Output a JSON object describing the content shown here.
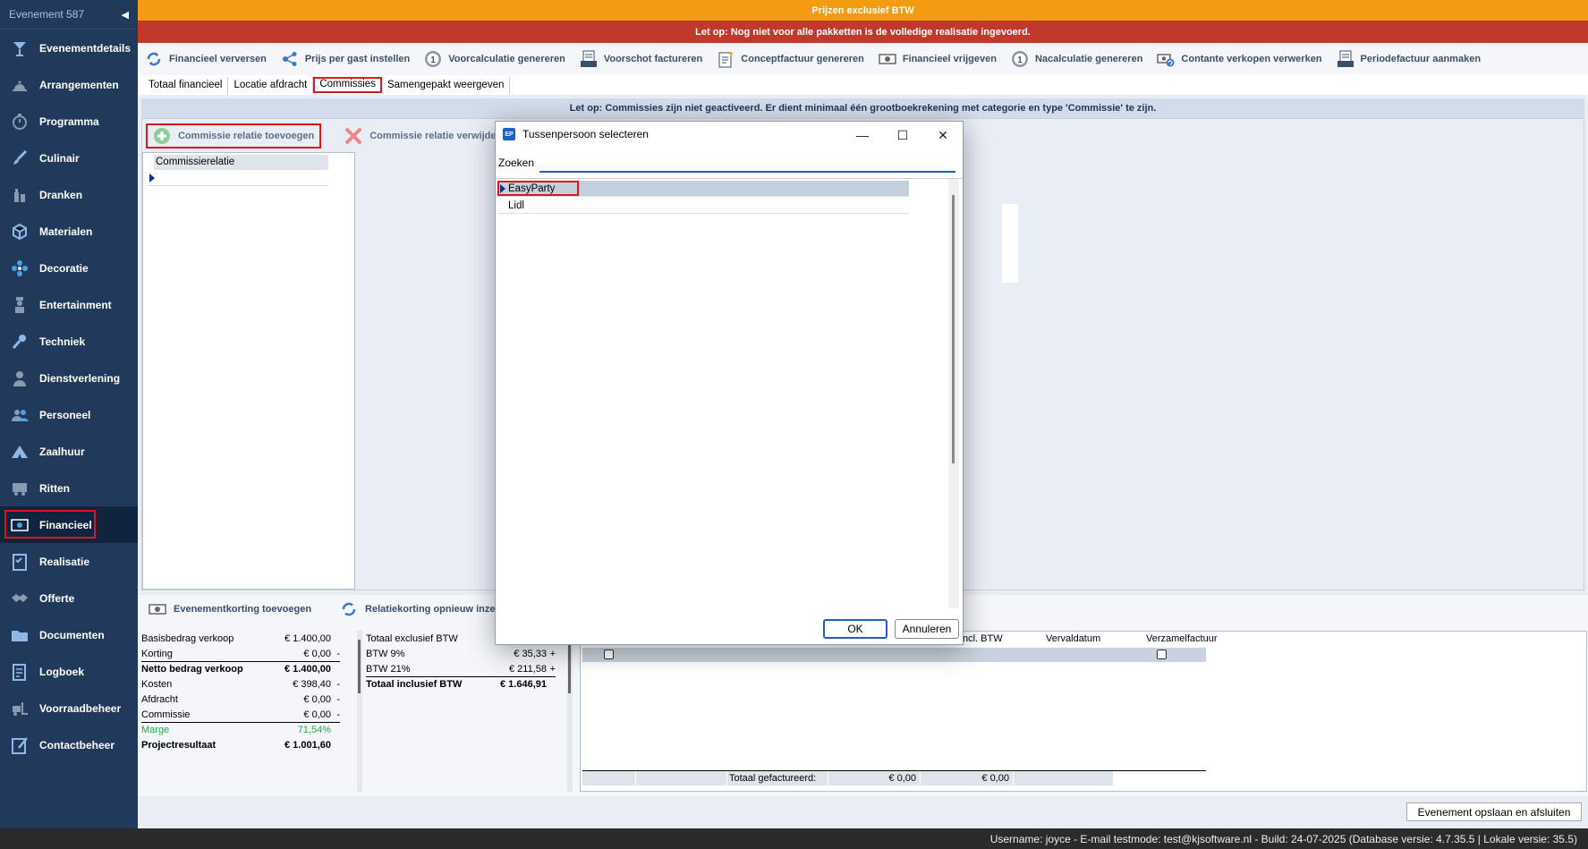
{
  "sidebar": {
    "event_title": "Evenement 587",
    "items": [
      {
        "label": "Evenementdetails",
        "icon": "cocktail-icon"
      },
      {
        "label": "Arrangementen",
        "icon": "bell-icon"
      },
      {
        "label": "Programma",
        "icon": "stopwatch-icon"
      },
      {
        "label": "Culinair",
        "icon": "brush-icon"
      },
      {
        "label": "Dranken",
        "icon": "bottles-icon"
      },
      {
        "label": "Materialen",
        "icon": "box-icon"
      },
      {
        "label": "Decoratie",
        "icon": "flower-icon"
      },
      {
        "label": "Entertainment",
        "icon": "performer-icon"
      },
      {
        "label": "Techniek",
        "icon": "microphone-icon"
      },
      {
        "label": "Dienstverlening",
        "icon": "waiter-icon"
      },
      {
        "label": "Personeel",
        "icon": "people-icon"
      },
      {
        "label": "Zaalhuur",
        "icon": "tent-icon"
      },
      {
        "label": "Ritten",
        "icon": "truck-icon"
      },
      {
        "label": "Financieel",
        "icon": "money-icon"
      },
      {
        "label": "Realisatie",
        "icon": "checklist-icon"
      },
      {
        "label": "Offerte",
        "icon": "handshake-icon"
      },
      {
        "label": "Documenten",
        "icon": "folder-icon"
      },
      {
        "label": "Logboek",
        "icon": "logbook-icon"
      },
      {
        "label": "Voorraadbeheer",
        "icon": "forklift-icon"
      },
      {
        "label": "Contactbeheer",
        "icon": "contact-edit-icon"
      }
    ]
  },
  "banners": {
    "orange": "Prijzen exclusief BTW",
    "red": "Let op: Nog niet voor alle pakketten is de volledige realisatie ingevoerd."
  },
  "toolbar": [
    {
      "label": "Financieel verversen",
      "icon": "refresh-icon"
    },
    {
      "label": "Prijs per gast instellen",
      "icon": "share-icon"
    },
    {
      "label": "Voorcalculatie genereren",
      "icon": "number-one-icon"
    },
    {
      "label": "Voorschot factureren",
      "icon": "invoice-icon"
    },
    {
      "label": "Conceptfactuur genereren",
      "icon": "draft-invoice-icon"
    },
    {
      "label": "Financieel vrijgeven",
      "icon": "cash-icon"
    },
    {
      "label": "Nacalculatie genereren",
      "icon": "number-one-icon"
    },
    {
      "label": "Contante verkopen verwerken",
      "icon": "cash-refresh-icon"
    },
    {
      "label": "Periodefactuur aanmaken",
      "icon": "invoice-icon"
    }
  ],
  "tabs": [
    "Totaal financieel",
    "Locatie afdracht",
    "Commissies",
    "Samengepakt weergeven"
  ],
  "commissions": {
    "notice": "Let op: Commissies zijn niet geactiveerd. Er dient minimaal één grootboekrekening met categorie en type 'Commissie' te zijn.",
    "add_label": "Commissie relatie toevoegen",
    "remove_label": "Commissie relatie verwijderen",
    "grid_header": "Commissierelatie"
  },
  "bottom": {
    "discount_label": "Evenementkorting toevoegen",
    "relation_discount_label": "Relatiekorting opnieuw inzetten",
    "summary1": [
      {
        "label": "Basisbedrag verkoop",
        "value": "€ 1.400,00",
        "op": ""
      },
      {
        "label": "Korting",
        "value": "€ 0,00",
        "op": "-"
      },
      {
        "label": "Netto bedrag verkoop",
        "value": "€ 1.400,00",
        "op": ""
      },
      {
        "label": "Kosten",
        "value": "€ 398,40",
        "op": "-"
      },
      {
        "label": "Afdracht",
        "value": "€ 0,00",
        "op": "-"
      },
      {
        "label": "Commissie",
        "value": "€ 0,00",
        "op": "-"
      },
      {
        "label": "Marge",
        "value": "71,54%",
        "op": ""
      },
      {
        "label": "Projectresultaat",
        "value": "€ 1.001,60",
        "op": ""
      }
    ],
    "summary2": [
      {
        "label": "Totaal exclusief BTW",
        "value": "",
        "op": ""
      },
      {
        "label": "BTW 9%",
        "value": "€ 35,33",
        "op": "+"
      },
      {
        "label": "BTW 21%",
        "value": "€ 211,58",
        "op": "+"
      },
      {
        "label": "Totaal inclusief BTW",
        "value": "€ 1.646,91",
        "op": ""
      }
    ],
    "invoice_headers": {
      "incl": "ncl. BTW",
      "due": "Vervaldatum",
      "collective": "Verzamelfactuur"
    },
    "invoice_total": {
      "label": "Totaal gefactureerd:",
      "v1": "€ 0,00",
      "v2": "€ 0,00"
    }
  },
  "save_button": "Evenement opslaan en afsluiten",
  "status_bar": "Username: joyce - E-mail testmode: test@kjsoftware.nl - Build: 24-07-2025 (Database versie: 4.7.35.5 | Lokale versie: 35.5)",
  "dialog": {
    "app_badge": "EP",
    "title": "Tussenpersoon selecteren",
    "search_label": "Zoeken",
    "search_value": "",
    "items": [
      "EasyParty",
      "Lidl"
    ],
    "ok": "OK",
    "cancel": "Annuleren"
  },
  "colors": {
    "sidebar": "#213a5c",
    "orange_banner": "#f39c12",
    "red_banner": "#c0392b",
    "highlight": "#e0161d",
    "accent": "#1f5fbf"
  }
}
